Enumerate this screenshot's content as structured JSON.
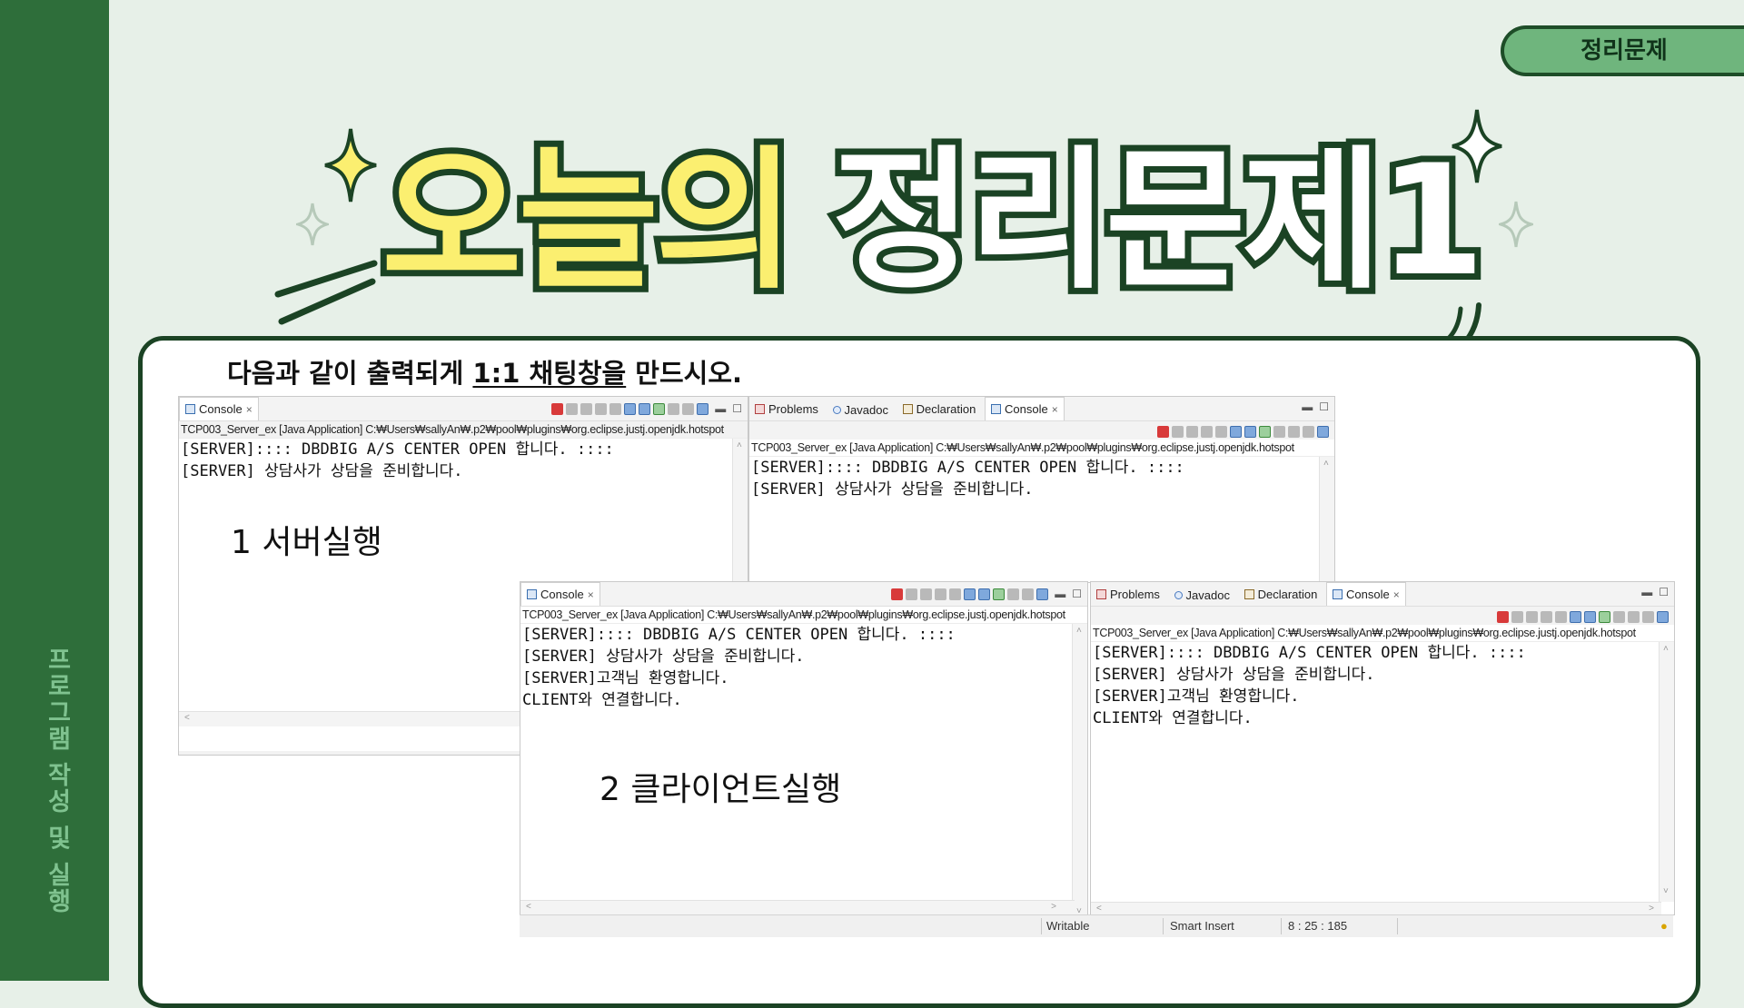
{
  "sidebar": {
    "vertical_text": "프로그램 작성 및 실행"
  },
  "badge": "정리문제",
  "title": {
    "part1": "오늘의",
    "part2": "정리문제1"
  },
  "instruction": {
    "pre": "다음과 같이 출력되게 ",
    "underlined": "1:1 채팅창을",
    "post": " 만드시오."
  },
  "notes": {
    "server": "1 서버실행",
    "client": "2 클라이언트실행"
  },
  "tabs": {
    "console": "Console",
    "problems": "Problems",
    "javadoc": "Javadoc",
    "declaration": "Declaration"
  },
  "path": "TCP003_Server_ex [Java Application] C:₩Users₩sallyAn₩.p2₩pool₩plugins₩org.eclipse.justj.openjdk.hotspot",
  "server_lines": [
    "[SERVER]:::: DBDBIG A/S CENTER OPEN 합니다. ::::",
    "[SERVER] 상담사가 상담을 준비합니다."
  ],
  "client_lines": [
    "[SERVER]:::: DBDBIG A/S CENTER OPEN 합니다. ::::",
    "[SERVER] 상담사가 상담을 준비합니다.",
    "[SERVER]고객님 환영합니다.",
    "CLIENT와 연결합니다."
  ],
  "statusbar": {
    "writable": "Writable",
    "insert_mode": "Smart Insert",
    "position": "8 : 25 : 185"
  },
  "colors": {
    "sidebar": "#2e6e3a",
    "background": "#e7f0e8",
    "title_yellow": "#fbef70",
    "outline": "#1b4324",
    "badge": "#6fb57d"
  }
}
